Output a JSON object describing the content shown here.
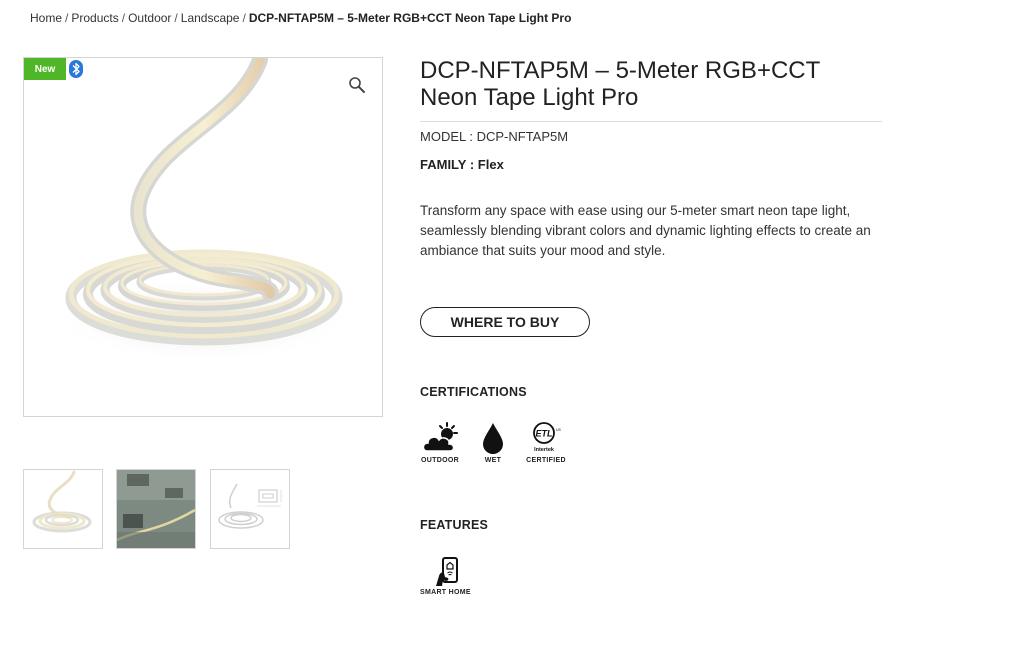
{
  "breadcrumb": {
    "items": [
      "Home",
      "Products",
      "Outdoor",
      "Landscape"
    ],
    "separator": "/",
    "current": "DCP-NFTAP5M – 5-Meter RGB+CCT Neon Tape Light Pro"
  },
  "gallery": {
    "badge": "New",
    "badge_color": "#4fb727",
    "bluetooth_color": "#2979d9",
    "zoom_icon": "magnifier-icon",
    "thumbnails": [
      "thumbnail-coil",
      "thumbnail-outdoor-install",
      "thumbnail-dimensions"
    ]
  },
  "product": {
    "title": "DCP-NFTAP5M – 5-Meter RGB+CCT Neon Tape Light Pro",
    "model": "MODEL : DCP-NFTAP5M",
    "family": "FAMILY : Flex",
    "description": "Transform any space with ease using our 5-meter smart neon tape light, seamlessly blending vibrant colors and dynamic lighting effects to create an ambiance that suits your mood and style.",
    "buy_button": "WHERE TO BUY"
  },
  "certifications": {
    "heading": "CERTIFICATIONS",
    "items": [
      {
        "label": "OUTDOOR",
        "icon": "cloud-sun-icon"
      },
      {
        "label": "WET",
        "icon": "water-drop-icon"
      },
      {
        "label": "CERTIFIED",
        "icon": "etl-intertek-icon",
        "logo_text": "ETL",
        "logo_sub": "Intertek"
      }
    ]
  },
  "features": {
    "heading": "FEATURES",
    "items": [
      {
        "label": "SMART HOME",
        "icon": "smart-phone-hand-icon"
      }
    ]
  }
}
